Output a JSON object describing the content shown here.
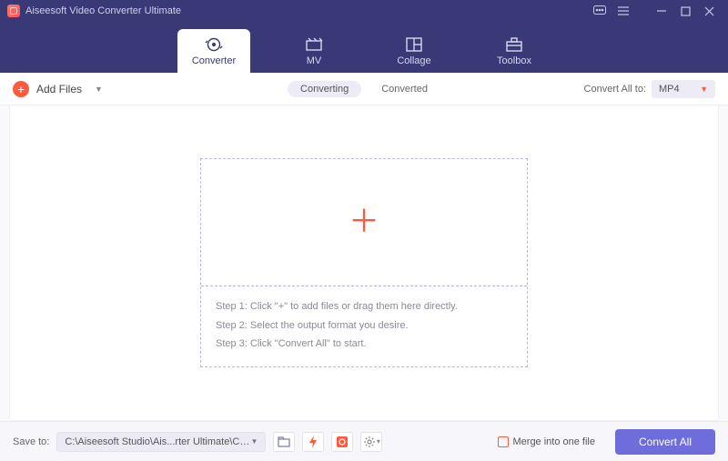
{
  "titlebar": {
    "title": "Aiseesoft Video Converter Ultimate"
  },
  "nav": {
    "tabs": [
      {
        "label": "Converter"
      },
      {
        "label": "MV"
      },
      {
        "label": "Collage"
      },
      {
        "label": "Toolbox"
      }
    ]
  },
  "toolbar": {
    "add_files_label": "Add Files",
    "subtabs": {
      "converting": "Converting",
      "converted": "Converted"
    },
    "convert_all_to_label": "Convert All to:",
    "format": "MP4"
  },
  "dropzone": {
    "step1": "Step 1: Click \"+\" to add files or drag them here directly.",
    "step2": "Step 2: Select the output format you desire.",
    "step3": "Step 3: Click \"Convert All\" to start."
  },
  "bottombar": {
    "save_to_label": "Save to:",
    "path": "C:\\Aiseesoft Studio\\Ais...rter Ultimate\\Converted",
    "merge_label": "Merge into one file",
    "convert_all_button": "Convert All"
  }
}
